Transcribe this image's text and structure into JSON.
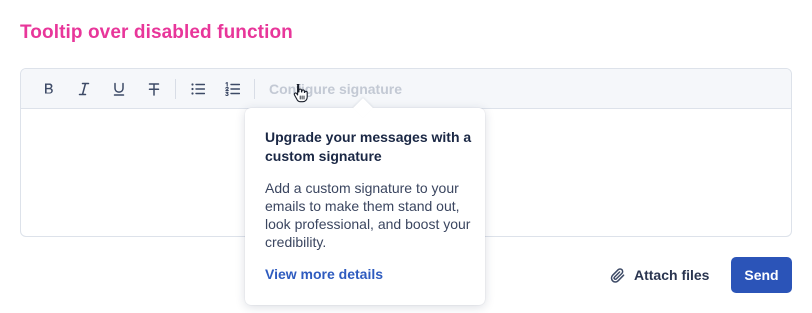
{
  "page": {
    "title": "Tooltip over disabled function"
  },
  "toolbar": {
    "buttons": [
      {
        "name": "bold",
        "icon": "bold-icon"
      },
      {
        "name": "italic",
        "icon": "italic-icon"
      },
      {
        "name": "underline",
        "icon": "underline-icon"
      },
      {
        "name": "strikethrough",
        "icon": "strikethrough-icon"
      },
      {
        "name": "bullet-list",
        "icon": "bullet-list-icon"
      },
      {
        "name": "numbered-list",
        "icon": "numbered-list-icon"
      }
    ],
    "configure_signature_label": "Configure signature",
    "configure_signature_disabled": true
  },
  "tooltip": {
    "title": "Upgrade your messages with a custom signature",
    "body": "Add a custom signature to your emails to make them stand out, look professional, and boost your credibility.",
    "link_label": "View more details"
  },
  "actions": {
    "attach_label": "Attach files",
    "send_label": "Send"
  },
  "colors": {
    "title_accent": "#e8369a",
    "primary_button": "#2b54b8",
    "link": "#2e5bbf",
    "disabled_text": "#c3c9d4"
  }
}
